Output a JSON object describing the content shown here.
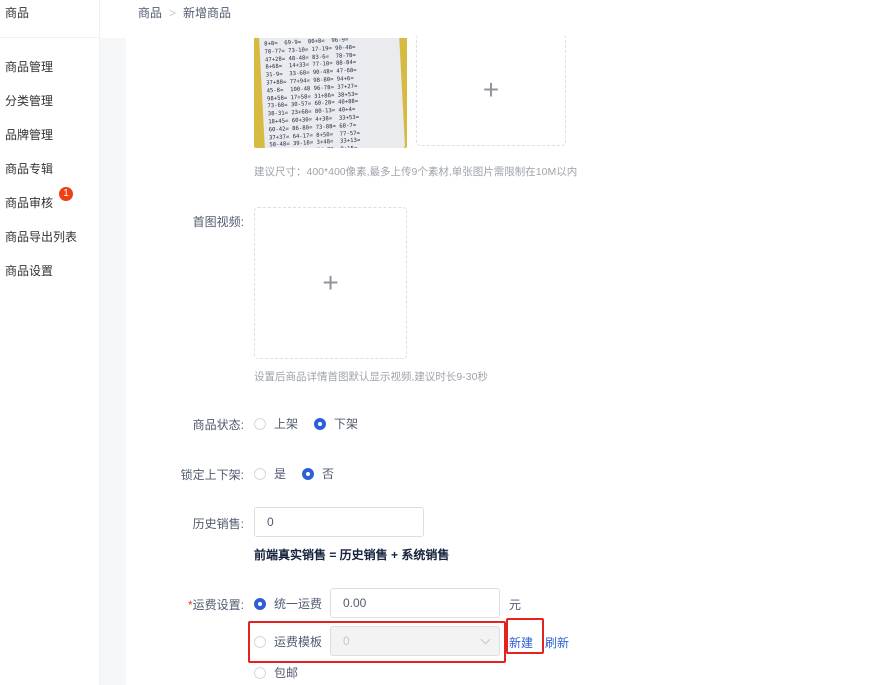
{
  "sidebar": {
    "title": "商品",
    "items": [
      {
        "label": "商品管理"
      },
      {
        "label": "分类管理"
      },
      {
        "label": "品牌管理"
      },
      {
        "label": "商品专辑"
      },
      {
        "label": "商品审核",
        "badge": "1"
      },
      {
        "label": "商品导出列表"
      },
      {
        "label": "商品设置"
      }
    ]
  },
  "breadcrumb": [
    "商品",
    "新增商品"
  ],
  "form": {
    "images": {
      "hint": "建议尺寸：400*400像素,最多上传9个素材,单张图片需限制在10M以内"
    },
    "video": {
      "label": "首图视频:",
      "hint": "设置后商品详情首图默认显示视频,建议时长9-30秒"
    },
    "status": {
      "label": "商品状态:",
      "options": [
        "上架",
        "下架"
      ],
      "selected": "下架"
    },
    "lock": {
      "label": "锁定上下架:",
      "options": [
        "是",
        "否"
      ],
      "selected": "否"
    },
    "history_sales": {
      "label": "历史销售:",
      "value": "0",
      "note": "前端真实销售 = 历史销售 + 系统销售"
    },
    "shipping": {
      "required_mark": "*",
      "label": "运费设置:",
      "uniform_label": "统一运费",
      "uniform_value": "0.00",
      "unit": "元",
      "template_label": "运费模板",
      "template_value": "0",
      "new_label": "新建",
      "refresh_label": "刷新",
      "free_label": "包邮"
    }
  },
  "colors": {
    "accent": "#2d5fd7",
    "badge": "#ed4014",
    "highlight": "#e52222"
  }
}
